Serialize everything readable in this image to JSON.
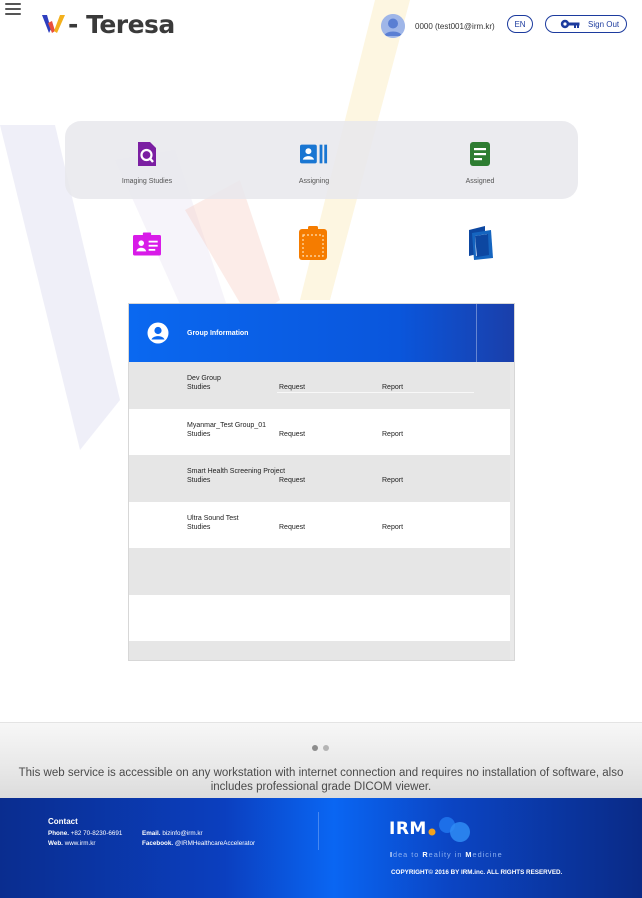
{
  "header": {
    "app_name": "W-Teresa",
    "logo_letter": "W",
    "logo_suffix": "- Teresa",
    "user_label": "0000 (test001@irm.kr)",
    "language": "EN",
    "sign_out": "Sign Out"
  },
  "menu": {
    "row1": [
      {
        "label": "Imaging Studies",
        "icon": "document-search-icon",
        "color": "#7b1fa2"
      },
      {
        "label": "Assigning",
        "icon": "id-card-list-icon",
        "color": "#1976d2"
      },
      {
        "label": "Assigned",
        "icon": "assignment-list-icon",
        "color": "#2e7d32"
      }
    ],
    "row2": [
      {
        "icon": "contact-card-icon",
        "color": "#d81be8"
      },
      {
        "icon": "clipboard-icon",
        "color": "#f57c00"
      },
      {
        "icon": "book-icon",
        "color": "#0d47a1"
      }
    ]
  },
  "group_panel": {
    "title": "Group Information",
    "header_color": "#0a68f0",
    "rows": [
      {
        "name": "Dev Group",
        "studies": "Studies",
        "request": "Request",
        "report": "Report"
      },
      {
        "name": "Myanmar_Test Group_01",
        "studies": "Studies",
        "request": "Request",
        "report": "Report"
      },
      {
        "name": "Smart Health Screening Project",
        "studies": "Studies",
        "request": "Request",
        "report": "Report"
      },
      {
        "name": "Ultra Sound Test",
        "studies": "Studies",
        "request": "Request",
        "report": "Report"
      }
    ]
  },
  "band": {
    "text": "This web service is accessible on any workstation with internet connection and requires no installation of software, also includes professional grade DICOM viewer."
  },
  "footer": {
    "contact_title": "Contact",
    "phone_label": "Phone.",
    "phone": "+82 70-8230-6691",
    "email_label": "Email.",
    "email": "bizinfo@irm.kr",
    "web_label": "Web.",
    "web": "www.irm.kr",
    "facebook_label": "Facebook.",
    "facebook": "@IRMHealthcareAccelerator",
    "irm_logo": "IRM",
    "tagline": [
      "I",
      "dea to ",
      "R",
      "eality in ",
      "M",
      "edicine"
    ],
    "copyright": "COPYRIGHT© 2016 BY IRM.inc. ALL RIGHTS RESERVED."
  }
}
